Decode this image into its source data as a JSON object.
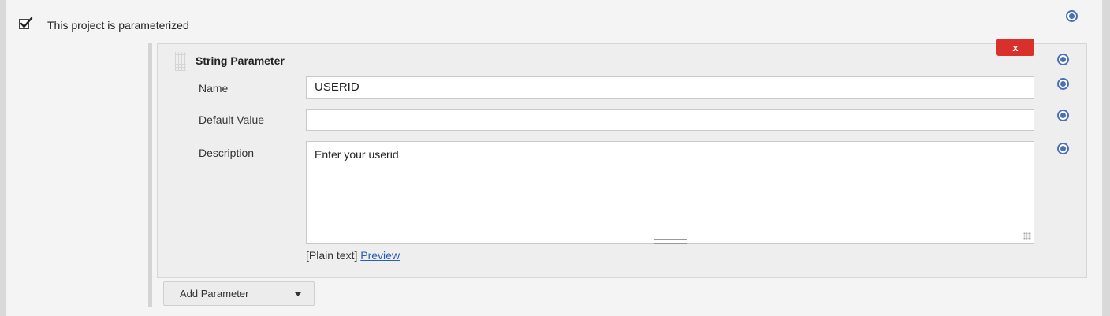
{
  "options": {
    "parameterized_checked": true,
    "parameterized_label": "This project is parameterized"
  },
  "parameter": {
    "type_title": "String Parameter",
    "delete_label": "x",
    "name_label": "Name",
    "name_value": "USERID",
    "default_label": "Default Value",
    "default_value": "",
    "description_label": "Description",
    "description_value": "Enter your userid",
    "markup_text": "[Plain text]",
    "preview_link": "Preview"
  },
  "add_parameter": {
    "label": "Add Parameter"
  },
  "icons": {
    "help": "help-icon",
    "check": "checkmark-icon",
    "caret": "chevron-down-icon",
    "grip": "drag-handle-icon"
  },
  "colors": {
    "delete_button": "#d9302b",
    "help_icon": "#4a6fb5",
    "link": "#2a5db0"
  }
}
